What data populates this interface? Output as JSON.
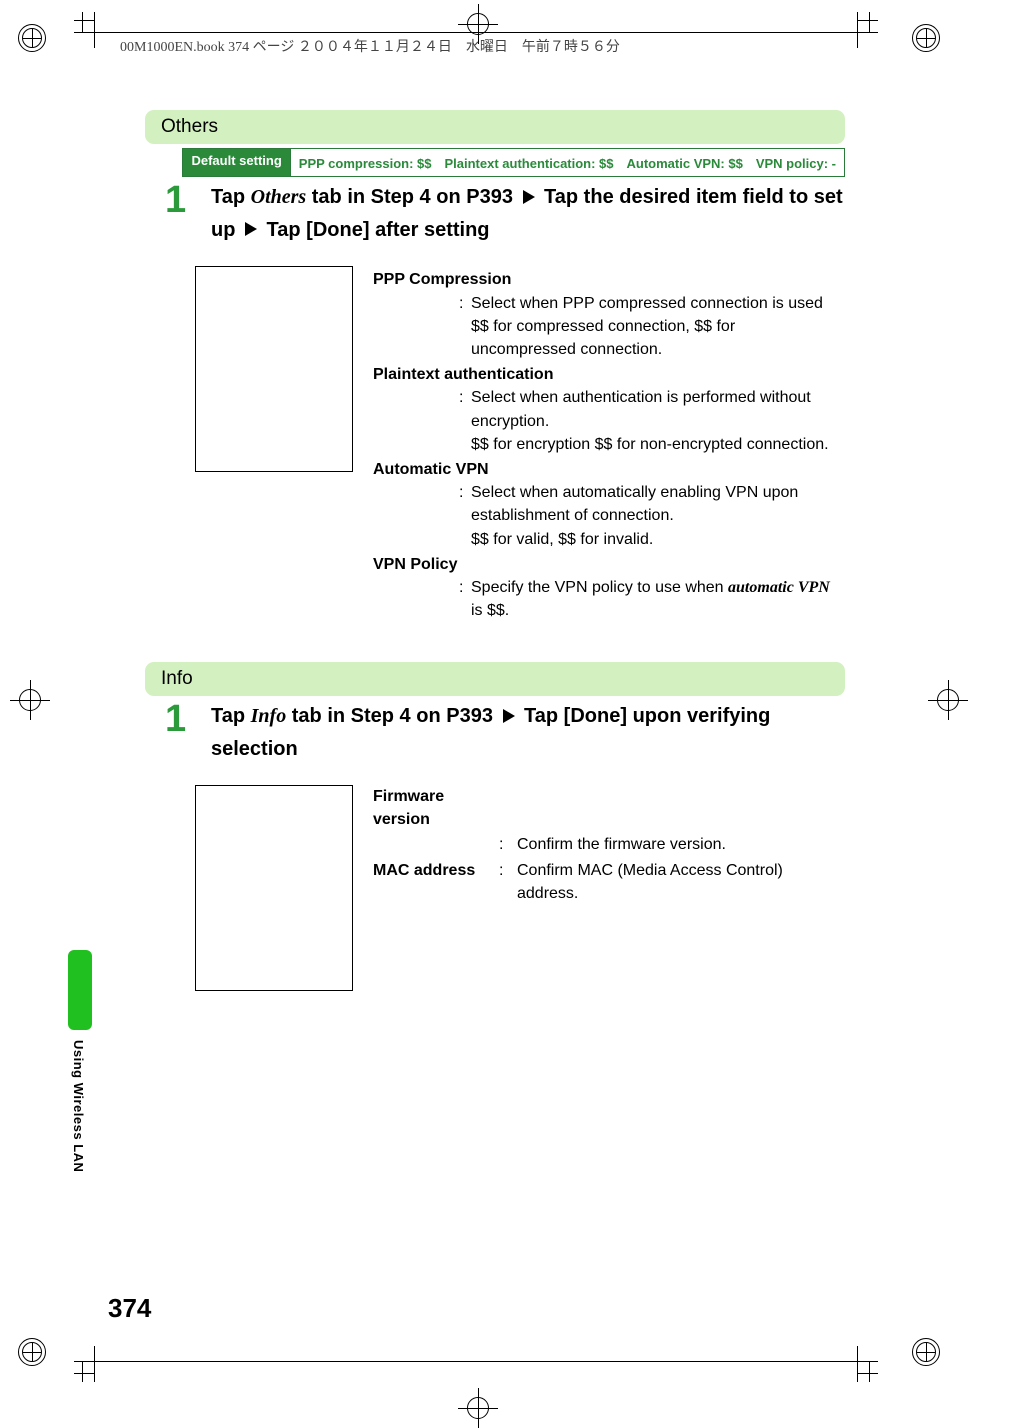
{
  "header_meta": "00M1000EN.book  374 ページ  ２００４年１１月２４日　水曜日　午前７時５６分",
  "page_number": "374",
  "side_text": "Using Wireless LAN",
  "others": {
    "section_title": "Others",
    "default_label": "Default setting",
    "default_value": "PPP compression: $$　Plaintext authentication: $$　Automatic VPN: $$　VPN policy: -",
    "step_num": "1",
    "step_a": "Tap ",
    "step_italic": "Others",
    "step_b": " tab in Step 4 on P393 ",
    "step_c": " Tap the desired item field to set up ",
    "step_d": " Tap [Done] after setting",
    "fields": {
      "ppp_title": "PPP Compression",
      "ppp_l1": "Select when PPP compressed connection is used",
      "ppp_l2": "$$ for compressed connection, $$ for",
      "ppp_l3": "uncompressed connection.",
      "plain_title": "Plaintext authentication",
      "plain_l1": "Select when authentication is performed without",
      "plain_l2": "encryption.",
      "plain_l3": "$$ for encryption $$ for non-encrypted connection.",
      "autovpn_title": "Automatic VPN",
      "autovpn_l1": "Select when automatically enabling VPN upon",
      "autovpn_l2": "establishment of connection.",
      "autovpn_l3": "$$ for valid, $$ for invalid.",
      "vpnpolicy_title": "VPN Policy",
      "vpnpolicy_l1a": "Specify the VPN policy to use when ",
      "vpnpolicy_l1b": "automatic VPN",
      "vpnpolicy_l2": "is $$."
    }
  },
  "info": {
    "section_title": "Info",
    "step_num": "1",
    "step_a": "Tap ",
    "step_italic": "Info",
    "step_b": " tab in Step 4 on P393 ",
    "step_c": " Tap [Done] upon verifying selection",
    "firmware_k": "Firmware version",
    "firmware_v": "Confirm the firmware version.",
    "mac_k": "MAC address",
    "mac_v": "Confirm MAC (Media Access Control) address."
  }
}
